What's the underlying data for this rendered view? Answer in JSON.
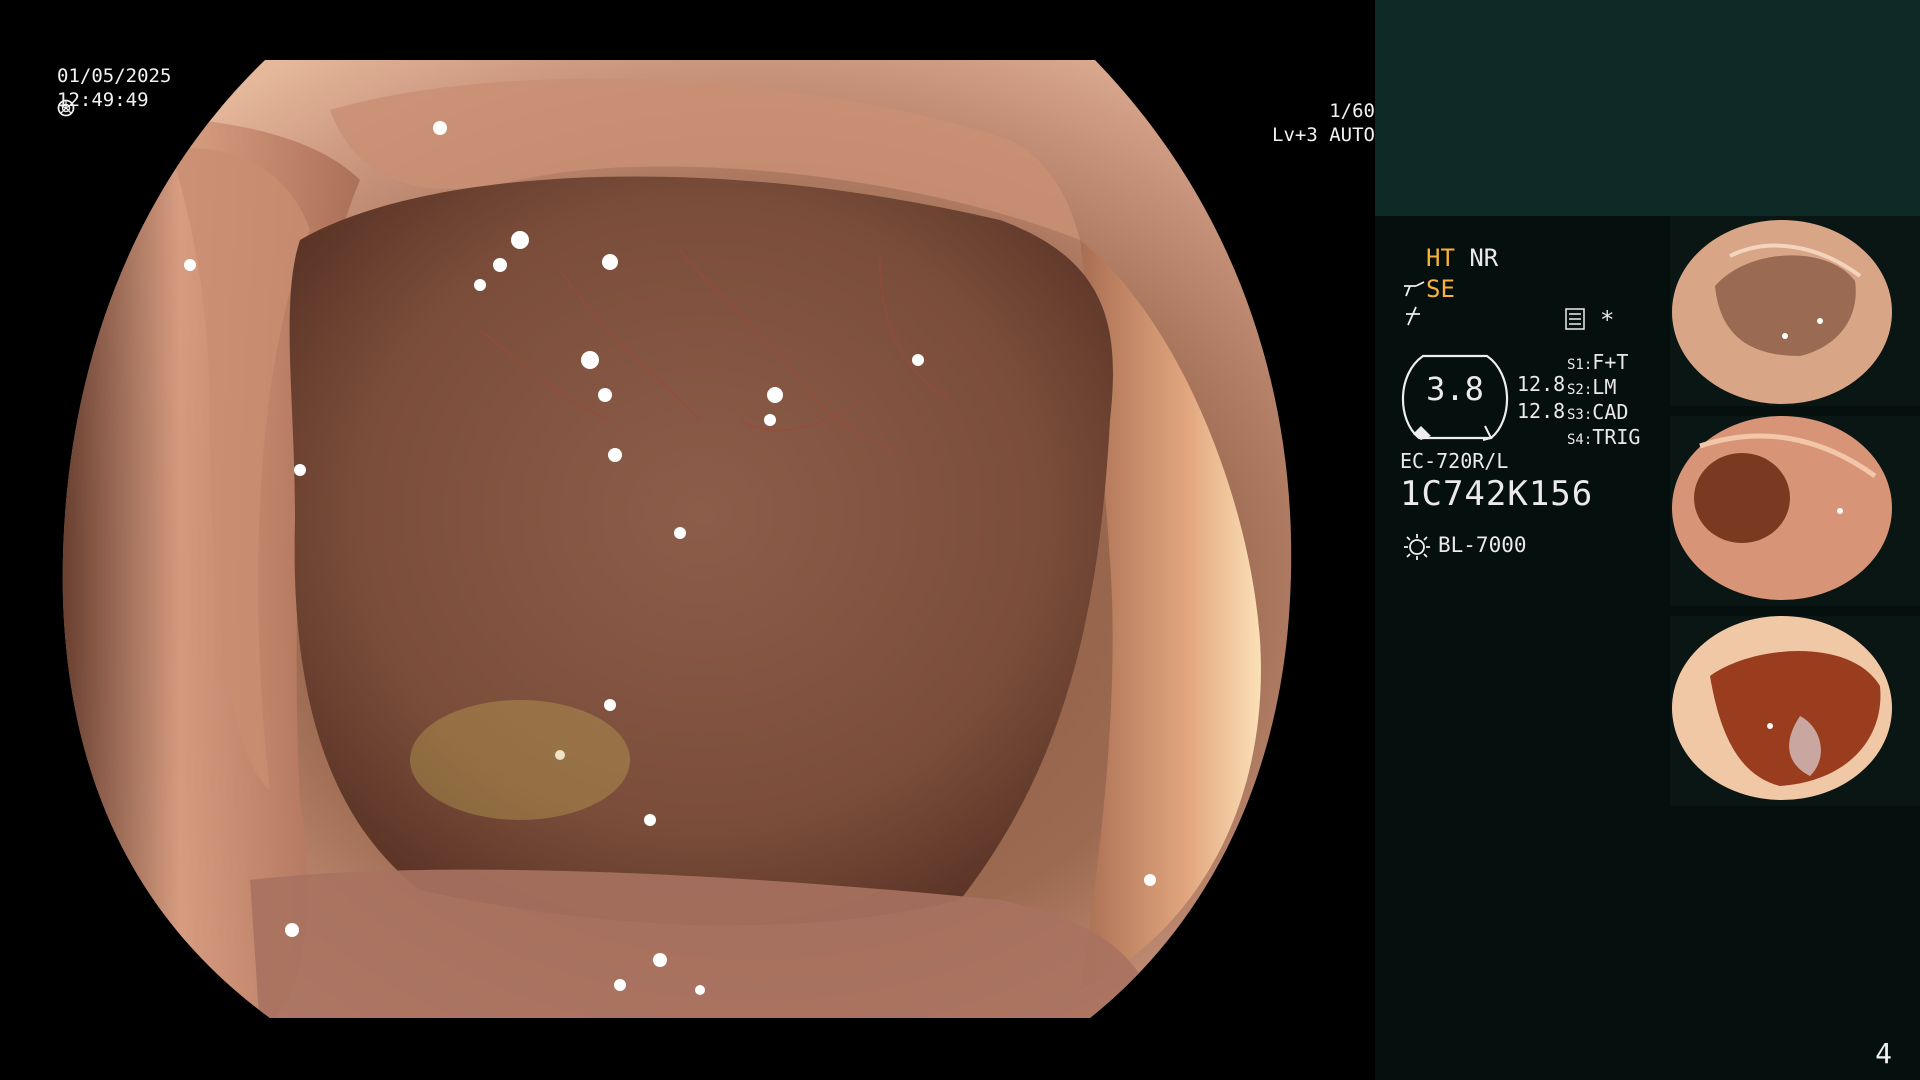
{
  "overlay": {
    "date": "01/05/2025",
    "time": "12:49:49",
    "shutter": "1/60",
    "level": "Lv+3 AUTO"
  },
  "panel": {
    "mode_ht": "HT",
    "mode_nr": "NR",
    "mode_se": "SE",
    "star": "*",
    "gauge_value": "3.8",
    "value_1": "12.8",
    "value_2": "12.8",
    "switches": [
      {
        "key": "S1:",
        "value": "F+T"
      },
      {
        "key": "S2:",
        "value": "LM"
      },
      {
        "key": "S3:",
        "value": "CAD"
      },
      {
        "key": "S4:",
        "value": "TRIG"
      }
    ],
    "scope_model": "EC-720R/L",
    "serial": "1C742K156",
    "light_source": "BL-7000",
    "page_number": "4"
  },
  "icons": [
    "shutter-icon",
    "auto-iris-icon",
    "structure-enhance-icon",
    "tone-icon",
    "memory-icon",
    "gauge-icon",
    "light-source-icon"
  ],
  "colors": {
    "accent": "#f6b23a",
    "panel_top": "#0e2a27",
    "panel": "#050f0d"
  }
}
